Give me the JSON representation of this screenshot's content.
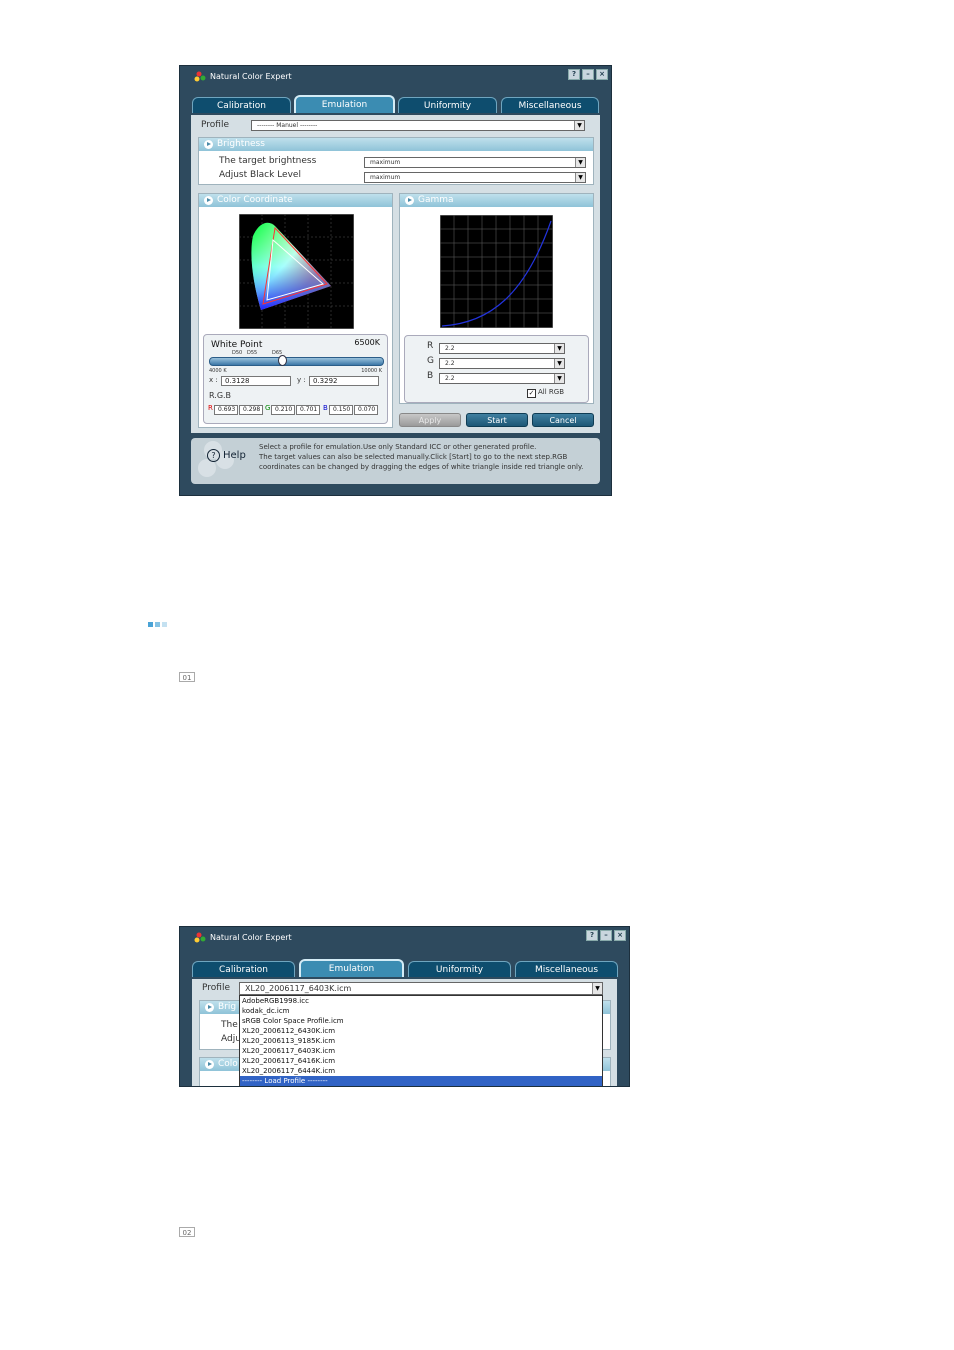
{
  "window1": {
    "title": "Natural Color Expert",
    "tabs": [
      {
        "label": "Calibration"
      },
      {
        "label": "Emulation"
      },
      {
        "label": "Uniformity"
      },
      {
        "label": "Miscellaneous"
      }
    ],
    "profile_label": "Profile",
    "profile_value": "-------- Manuel --------",
    "brightness": {
      "header": "Brightness",
      "target_label": "The target brightness",
      "target_value": "maximum",
      "black_label": "Adjust Black Level",
      "black_value": "maximum"
    },
    "color_coordinate": {
      "header": "Color Coordinate",
      "white_point_label": "White Point",
      "white_point_value": "6500K",
      "slider_marks": [
        "D50",
        "D55",
        "D65"
      ],
      "slider_min": "4000 K",
      "slider_max": "10000 K",
      "x_label": "x :",
      "x_value": "0.3128",
      "y_label": "y :",
      "y_value": "0.3292",
      "rgb_label": "R.G.B",
      "rgb": {
        "r_label": "R",
        "r1": "0.693",
        "r2": "0.298",
        "g_label": "G",
        "g1": "0.210",
        "g2": "0.701",
        "b_label": "B",
        "b1": "0.150",
        "b2": "0.070"
      }
    },
    "gamma": {
      "header": "Gamma",
      "r_label": "R",
      "r_value": "2.2",
      "g_label": "G",
      "g_value": "2.2",
      "b_label": "B",
      "b_value": "2.2",
      "all_rgb_label": "All RGB",
      "all_rgb_checked": true
    },
    "buttons": {
      "apply": "Apply",
      "start": "Start",
      "cancel": "Cancel"
    },
    "help": {
      "label": "Help",
      "lines": [
        "Select a profile for emulation.Use only Standard ICC or other generated profile.",
        "The target values can also be selected manually.Click [Start] to go to the next step.RGB",
        "coordinates can be changed by dragging the edges of white triangle inside red triangle only."
      ]
    }
  },
  "marker1": "01",
  "window2": {
    "title": "Natural Color Expert",
    "tabs": [
      {
        "label": "Calibration"
      },
      {
        "label": "Emulation"
      },
      {
        "label": "Uniformity"
      },
      {
        "label": "Miscellaneous"
      }
    ],
    "profile_label": "Profile",
    "profile_value": "XL20_2006117_6403K.icm",
    "partial_labels": {
      "brightness": "Brig",
      "the": "The",
      "adju": "Adju",
      "color": "Colo"
    },
    "dropdown_items": [
      "AdobeRGB1998.icc",
      "kodak_dc.icm",
      "sRGB Color Space Profile.icm",
      "XL20_2006112_6430K.icm",
      "XL20_2006113_9185K.icm",
      "XL20_2006117_6403K.icm",
      "XL20_2006117_6416K.icm",
      "XL20_2006117_6444K.icm",
      "-------- Load Profile --------"
    ],
    "selected_index": 8
  },
  "marker2": "02",
  "colors": {
    "window_bg": "#2e4a5e",
    "tab_bg": "#0e4d6e",
    "tab_active": "#3b8cb2",
    "header": "#8fc3d8",
    "select_blue": "#3163c5"
  }
}
